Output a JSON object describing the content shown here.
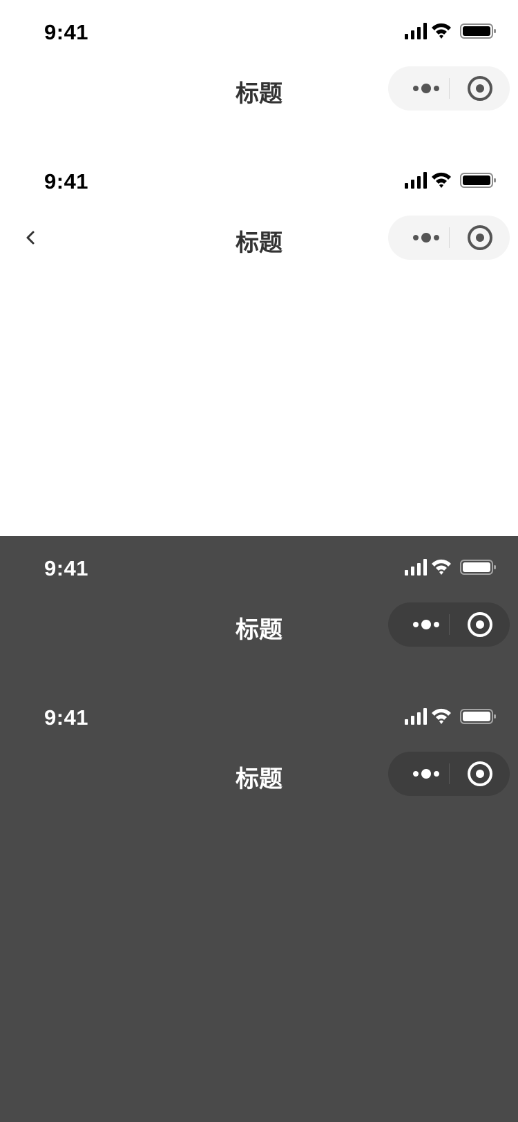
{
  "light_headers": [
    {
      "time": "9:41",
      "title": "标题",
      "has_back": false
    },
    {
      "time": "9:41",
      "title": "标题",
      "has_back": true
    }
  ],
  "dark_headers": [
    {
      "time": "9:41",
      "title": "标题",
      "has_back": false
    },
    {
      "time": "9:41",
      "title": "标题",
      "has_back": false
    }
  ],
  "colors": {
    "light_background": "#ffffff",
    "dark_background": "#4a4a4a",
    "light_title": "#333333",
    "dark_title": "#ffffff",
    "light_capsule": "#f4f4f4",
    "dark_capsule": "#3e3e3e"
  },
  "icons": {
    "status_bar": [
      "cellular-signal-icon",
      "wifi-icon",
      "battery-icon"
    ],
    "capsule": [
      "more-options-icon",
      "close-miniprogram-icon"
    ],
    "navigation": "chevron-left-icon"
  }
}
